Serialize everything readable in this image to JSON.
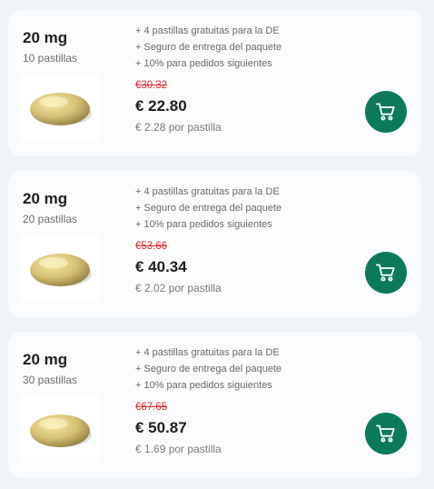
{
  "products": [
    {
      "dose": "20 mg",
      "count": "10 pastillas",
      "perks": [
        "+ 4 pastillas gratuitas para la DE",
        "+ Seguro de entrega del paquete",
        "+ 10% para pedidos siguientes"
      ],
      "old_price": "€30.32",
      "price": "€ 22.80",
      "per_pill": "€ 2.28 por pastilla",
      "pill_icon": "pill-icon",
      "cart_icon": "cart-icon"
    },
    {
      "dose": "20 mg",
      "count": "20 pastillas",
      "perks": [
        "+ 4 pastillas gratuitas para la DE",
        "+ Seguro de entrega del paquete",
        "+ 10% para pedidos siguientes"
      ],
      "old_price": "€53.66",
      "price": "€ 40.34",
      "per_pill": "€ 2.02 por pastilla",
      "pill_icon": "pill-icon",
      "cart_icon": "cart-icon"
    },
    {
      "dose": "20 mg",
      "count": "30 pastillas",
      "perks": [
        "+ 4 pastillas gratuitas para la DE",
        "+ Seguro de entrega del paquete",
        "+ 10% para pedidos siguientes"
      ],
      "old_price": "€67.65",
      "price": "€ 50.87",
      "per_pill": "€ 1.69 por pastilla",
      "pill_icon": "pill-icon",
      "cart_icon": "cart-icon"
    }
  ],
  "colors": {
    "accent": "#0c7a5a",
    "old_price": "#d8302f",
    "card_bg": "#f9fbfd",
    "page_bg": "#f1f4f7"
  }
}
